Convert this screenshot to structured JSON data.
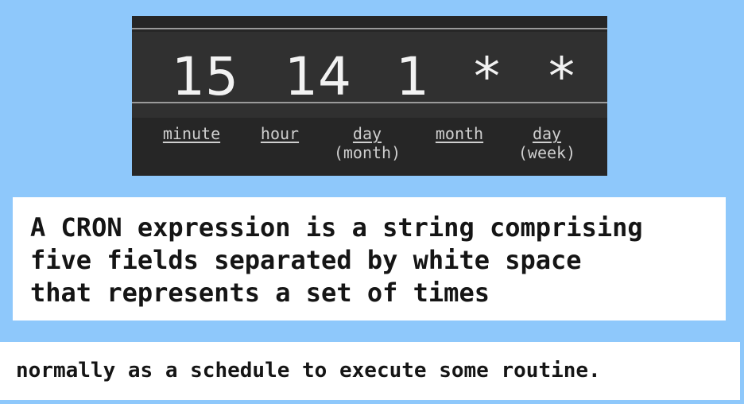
{
  "cron": {
    "tokens": {
      "minute": "15",
      "hour": "14",
      "day_month": "1",
      "month": "*",
      "day_week": "*"
    },
    "labels": {
      "minute": "minute",
      "hour": "hour",
      "day_month": "day",
      "day_month_sub": "(month)",
      "month": "month",
      "day_week": "day",
      "day_week_sub": "(week)"
    }
  },
  "definition": {
    "line1": "A CRON expression is a string comprising",
    "line2": "five fields separated by white space",
    "line3": "that represents a set of times"
  },
  "note": {
    "text": "normally as a schedule to execute some routine."
  }
}
